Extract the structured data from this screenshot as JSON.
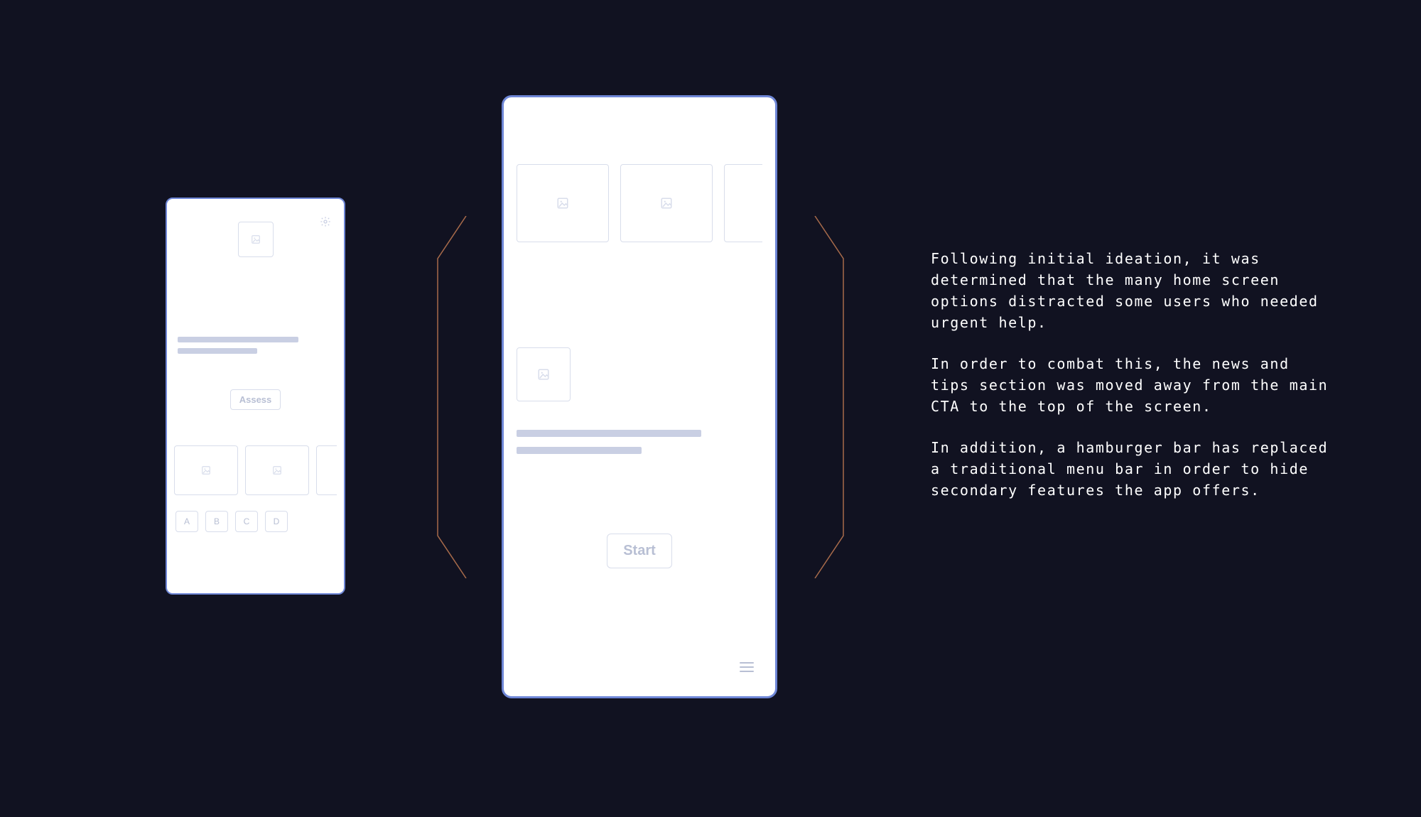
{
  "phone_small": {
    "cta_label": "Assess",
    "tabs": [
      "A",
      "B",
      "C",
      "D"
    ]
  },
  "phone_large": {
    "cta_label": "Start"
  },
  "copy": {
    "p1": "Following initial ideation, it was determined that the many home screen options distracted some users who needed urgent help.",
    "p2": "In order to combat this, the news and tips section was moved away from the main CTA to the top of the screen.",
    "p3": "In addition, a hamburger bar has replaced a traditional menu bar in order to hide secondary features the app offers."
  }
}
